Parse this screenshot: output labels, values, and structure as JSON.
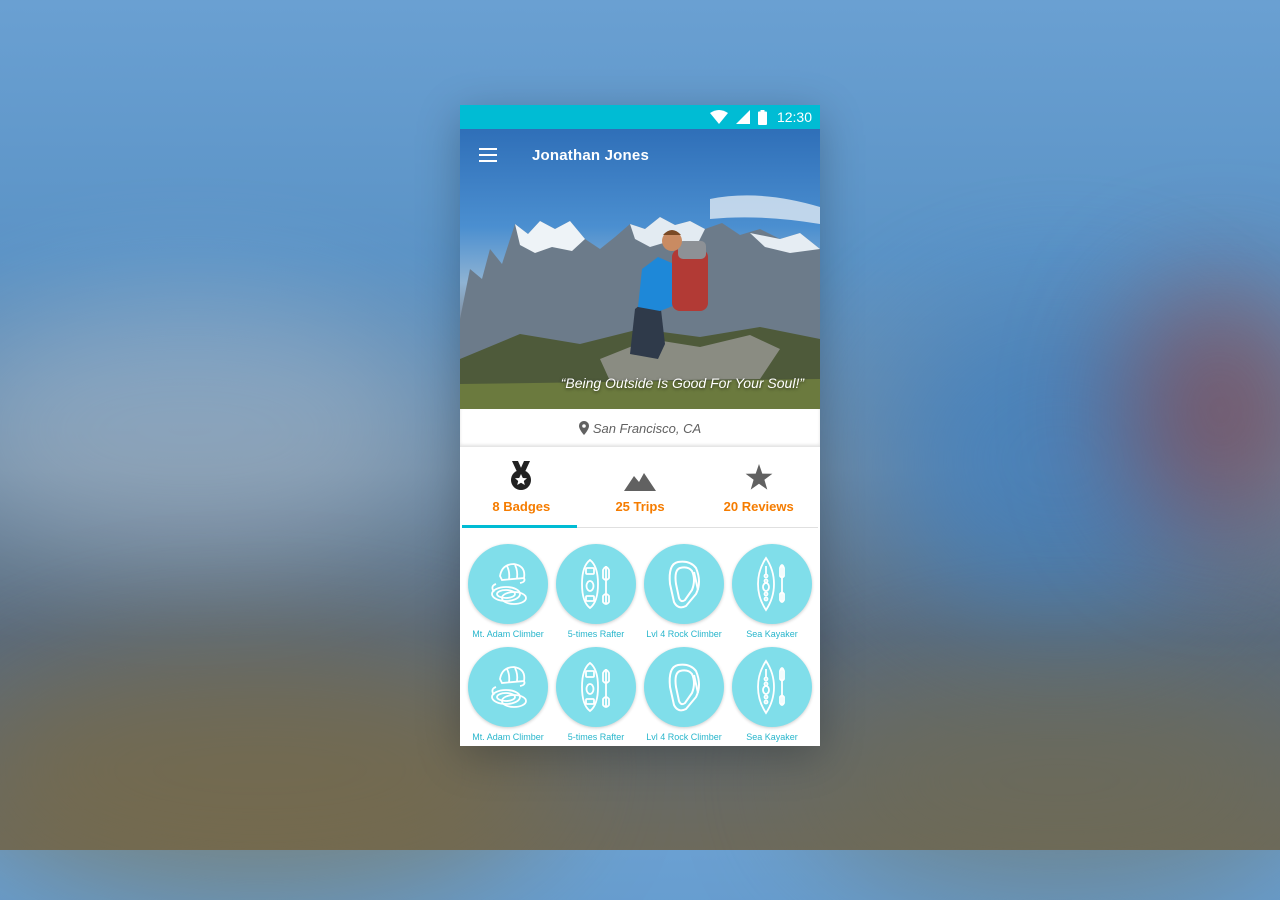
{
  "status_bar": {
    "time": "12:30"
  },
  "app_bar": {
    "title": "Jonathan Jones"
  },
  "profile": {
    "quote": "“Being Outside Is Good For Your Soul!”",
    "location": "San Francisco, CA"
  },
  "tabs": [
    {
      "label": "8 Badges",
      "icon": "medal-icon"
    },
    {
      "label": "25 Trips",
      "icon": "mountain-icon"
    },
    {
      "label": "20 Reviews",
      "icon": "star-icon"
    }
  ],
  "badges": [
    {
      "label": "Mt. Adam Climber",
      "icon": "helmet-rope-icon"
    },
    {
      "label": "5-times Rafter",
      "icon": "raft-paddle-icon"
    },
    {
      "label": "Lvl 4 Rock Climber",
      "icon": "carabiner-icon"
    },
    {
      "label": "Sea Kayaker",
      "icon": "kayak-paddle-icon"
    },
    {
      "label": "Mt. Adam Climber",
      "icon": "helmet-rope-icon"
    },
    {
      "label": "5-times Rafter",
      "icon": "raft-paddle-icon"
    },
    {
      "label": "Lvl 4 Rock Climber",
      "icon": "carabiner-icon"
    },
    {
      "label": "Sea Kayaker",
      "icon": "kayak-paddle-icon"
    }
  ],
  "colors": {
    "primary": "#00bcd4",
    "accent": "#f57c00",
    "badge_fill": "#80deea",
    "badge_label": "#29b6cc"
  }
}
